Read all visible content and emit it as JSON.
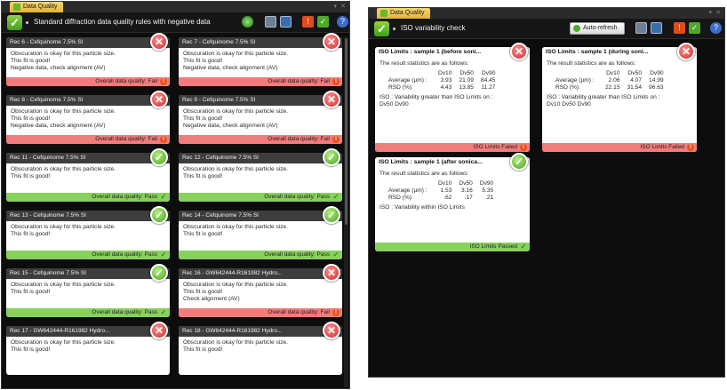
{
  "left": {
    "tab": "Data Quality",
    "toolbar_title": "Standard diffraction data quality rules with negative data",
    "cards": [
      {
        "title": "Rec 6 - Cefquinome 7.5% SI",
        "lines": [
          "Obscuration is okay for this particle size.",
          "This fit is good!",
          "Negative data, check alignment (AV)"
        ],
        "footer": "Overall data quality: Fail",
        "status": "fail"
      },
      {
        "title": "Rec 7 - Cefquinome 7.5% SI",
        "lines": [
          "Obscuration is okay for this particle size.",
          "This fit is good!",
          "Negative data, check alignment (AV)"
        ],
        "footer": "Overall data quality: Fail",
        "status": "fail"
      },
      {
        "title": "Rec 8 - Cefquinome 7.5% SI",
        "lines": [
          "Obscuration is okay for this particle size.",
          "This fit is good!",
          "Negative data, check alignment (AV)"
        ],
        "footer": "Overall data quality: Fail",
        "status": "fail"
      },
      {
        "title": "Rec 9 - Cefquinome 7.5% SI",
        "lines": [
          "Obscuration is okay for this particle size.",
          "This fit is good!",
          "Negative data, check alignment (AV)"
        ],
        "footer": "Overall data quality: Fail",
        "status": "fail"
      },
      {
        "title": "Rec 11 - Cefquinome 7.5% SI",
        "lines": [
          "Obscuration is okay for this particle size.",
          "This fit is good!"
        ],
        "footer": "Overall data quality: Pass",
        "status": "pass"
      },
      {
        "title": "Rec 12 - Cefquinome 7.5% SI",
        "lines": [
          "Obscuration is okay for this particle size.",
          "This fit is good!"
        ],
        "footer": "Overall data quality: Pass",
        "status": "pass"
      },
      {
        "title": "Rec 13 - Cefquinome 7.5% SI",
        "lines": [
          "Obscuration is okay for this particle size.",
          "This fit is good!"
        ],
        "footer": "Overall data quality: Pass",
        "status": "pass"
      },
      {
        "title": "Rec 14 - Cefquinome 7.5% SI",
        "lines": [
          "Obscuration is okay for this particle size.",
          "This fit is good!"
        ],
        "footer": "Overall data quality: Pass",
        "status": "pass"
      },
      {
        "title": "Rec 15 - Cefquinome 7.5% SI",
        "lines": [
          "Obscuration is okay for this particle size.",
          "This fit is good!"
        ],
        "footer": "Overall data quality: Pass",
        "status": "pass"
      },
      {
        "title": "Rec 16 - GW642444-R161982 Hydro...",
        "lines": [
          "Obscuration is okay for this particle size.",
          "This fit is good!",
          "Check alignment (AV)"
        ],
        "footer": "Overall data quality: Fail",
        "status": "fail"
      },
      {
        "title": "Rec 17 - GW642444-R161982 Hydro...",
        "lines": [
          "Obscuration is okay for this particle size.",
          "This fit is good!"
        ],
        "footer": "",
        "status": "fail"
      },
      {
        "title": "Rec 18 - GW642444-R161982 Hydro...",
        "lines": [
          "Obscuration is okay for this particle size.",
          "This fit is good!"
        ],
        "footer": "",
        "status": "fail"
      }
    ]
  },
  "right": {
    "tab": "Data Quality",
    "toolbar_title": "ISO variability check",
    "auto_refresh": "Auto-refresh",
    "cards": [
      {
        "title": "ISO Limits : sample 1 (before soni...",
        "intro": "The result statistics are as follows:",
        "cols": [
          "",
          "Dv10",
          "Dv50",
          "Dv90"
        ],
        "rows": [
          [
            "Average (µm) :",
            "3.93",
            "21.09",
            "84.45"
          ],
          [
            "RSD (%):",
            "4.43",
            "13.85",
            "11.27"
          ]
        ],
        "iso_text": "ISO :    Variability greater than ISO Limits on :",
        "iso_text2": "Dv50  Dv90",
        "footer": "ISO Limits Failed",
        "status": "fail"
      },
      {
        "title": "ISO Limits : sample 1 (during soni...",
        "intro": "The result statistics are as follows:",
        "cols": [
          "",
          "Dv10",
          "Dv50",
          "Dv90"
        ],
        "rows": [
          [
            "Average (µm) :",
            "2.06",
            "4.07",
            "14.99"
          ],
          [
            "RSD (%):",
            "22.15",
            "31.54",
            "96.63"
          ]
        ],
        "iso_text": "ISO :    Variability greater than ISO Limits on :",
        "iso_text2": "Dv10  Dv50  Dv90",
        "footer": "ISO Limits Failed",
        "status": "fail"
      },
      {
        "title": "ISO Limits : sample 1 (after sonica...",
        "intro": "The result statistics are as follows:",
        "cols": [
          "",
          "Dv10",
          "Dv50",
          "Dv90"
        ],
        "rows": [
          [
            "Average (µm) :",
            "1.53",
            "3.16",
            "5.35"
          ],
          [
            "RSD (%):",
            ".62",
            ".17",
            ".21"
          ]
        ],
        "iso_text": "ISO :    Variability within ISO Limits",
        "iso_text2": "",
        "footer": "ISO Limits Passed",
        "status": "pass"
      }
    ]
  },
  "colors": {
    "fail": "#f27b7b",
    "pass": "#88d15c",
    "panel": "#0d0d0d",
    "tab": "#f2cc5a"
  }
}
